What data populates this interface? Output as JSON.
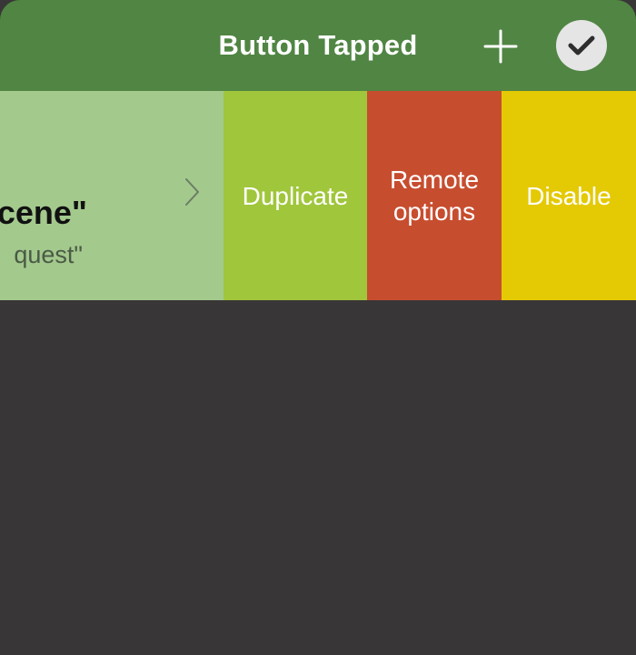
{
  "header": {
    "title": "Button Tapped",
    "add_icon": "plus-icon",
    "done_icon": "checkmark-icon"
  },
  "row": {
    "title": "cene\"",
    "subtitle": "quest\"",
    "chevron_icon": "chevron-right-icon"
  },
  "actions": [
    {
      "label": "Duplicate",
      "color": "#a0c63c"
    },
    {
      "label": "Remote\noptions",
      "color": "#c74d2f"
    },
    {
      "label": "Disable",
      "color": "#e4c905"
    }
  ],
  "colors": {
    "header": "#508543",
    "row_background": "#a3c98d",
    "background": "#393637"
  }
}
